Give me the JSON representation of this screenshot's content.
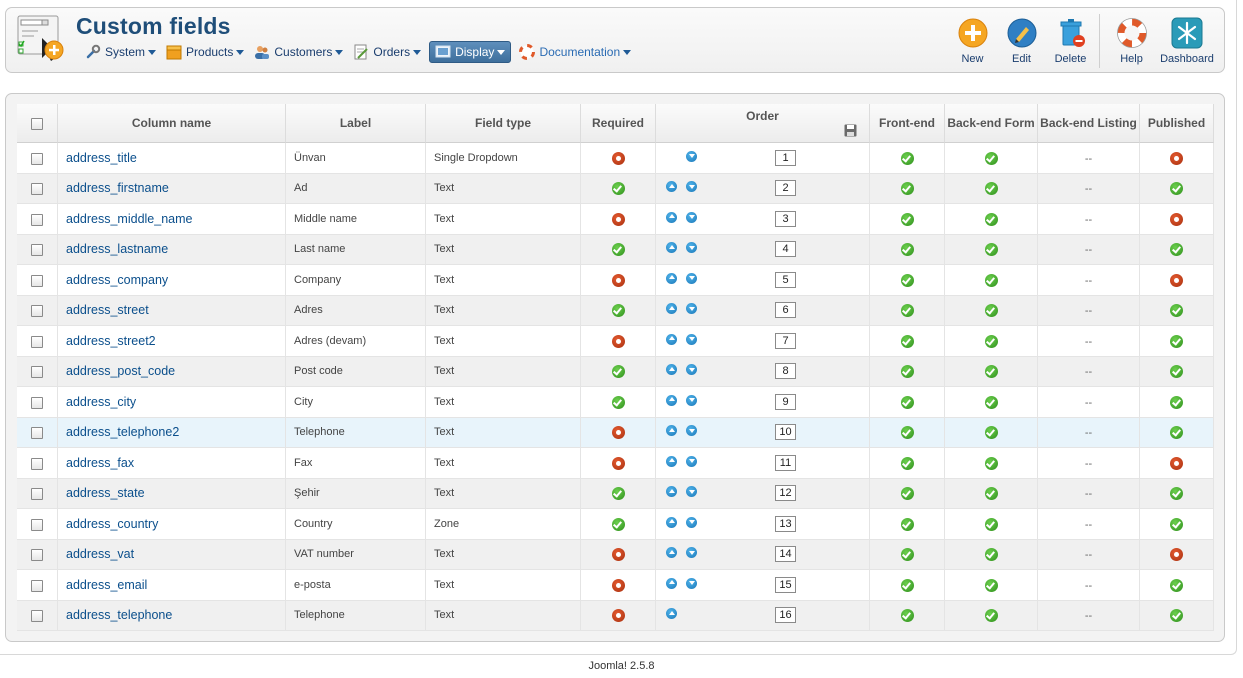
{
  "header": {
    "title": "Custom fields",
    "menu": [
      {
        "label": "System",
        "icon": "wrench-icon",
        "active": false
      },
      {
        "label": "Products",
        "icon": "box-icon",
        "active": false
      },
      {
        "label": "Customers",
        "icon": "users-icon",
        "active": false
      },
      {
        "label": "Orders",
        "icon": "orders-icon",
        "active": false
      },
      {
        "label": "Display",
        "icon": "display-icon",
        "active": true
      },
      {
        "label": "Documentation",
        "icon": "lifebuoy-icon",
        "active": false
      }
    ],
    "toolbar": {
      "new_label": "New",
      "edit_label": "Edit",
      "delete_label": "Delete",
      "help_label": "Help",
      "dashboard_label": "Dashboard"
    }
  },
  "table": {
    "headers": {
      "column_name": "Column name",
      "label": "Label",
      "field_type": "Field type",
      "required": "Required",
      "order": "Order",
      "front_end": "Front-end",
      "back_end_form": "Back-end Form",
      "back_end_listing": "Back-end Listing",
      "published": "Published"
    },
    "rows": [
      {
        "column": "address_title",
        "label": "Ünvan",
        "type": "Single Dropdown",
        "required": false,
        "up": false,
        "down": true,
        "order": "1",
        "front": true,
        "backform": true,
        "listing": "--",
        "published": false
      },
      {
        "column": "address_firstname",
        "label": "Ad",
        "type": "Text",
        "required": true,
        "up": true,
        "down": true,
        "order": "2",
        "front": true,
        "backform": true,
        "listing": "--",
        "published": true
      },
      {
        "column": "address_middle_name",
        "label": "Middle name",
        "type": "Text",
        "required": false,
        "up": true,
        "down": true,
        "order": "3",
        "front": true,
        "backform": true,
        "listing": "--",
        "published": false
      },
      {
        "column": "address_lastname",
        "label": "Last name",
        "type": "Text",
        "required": true,
        "up": true,
        "down": true,
        "order": "4",
        "front": true,
        "backform": true,
        "listing": "--",
        "published": true
      },
      {
        "column": "address_company",
        "label": "Company",
        "type": "Text",
        "required": false,
        "up": true,
        "down": true,
        "order": "5",
        "front": true,
        "backform": true,
        "listing": "--",
        "published": false
      },
      {
        "column": "address_street",
        "label": "Adres",
        "type": "Text",
        "required": true,
        "up": true,
        "down": true,
        "order": "6",
        "front": true,
        "backform": true,
        "listing": "--",
        "published": true
      },
      {
        "column": "address_street2",
        "label": "Adres (devam)",
        "type": "Text",
        "required": false,
        "up": true,
        "down": true,
        "order": "7",
        "front": true,
        "backform": true,
        "listing": "--",
        "published": true
      },
      {
        "column": "address_post_code",
        "label": "Post code",
        "type": "Text",
        "required": true,
        "up": true,
        "down": true,
        "order": "8",
        "front": true,
        "backform": true,
        "listing": "--",
        "published": true
      },
      {
        "column": "address_city",
        "label": "City",
        "type": "Text",
        "required": true,
        "up": true,
        "down": true,
        "order": "9",
        "front": true,
        "backform": true,
        "listing": "--",
        "published": true
      },
      {
        "column": "address_telephone2",
        "label": "Telephone",
        "type": "Text",
        "required": false,
        "up": true,
        "down": true,
        "order": "10",
        "front": true,
        "backform": true,
        "listing": "--",
        "published": true
      },
      {
        "column": "address_fax",
        "label": "Fax",
        "type": "Text",
        "required": false,
        "up": true,
        "down": true,
        "order": "11",
        "front": true,
        "backform": true,
        "listing": "--",
        "published": false
      },
      {
        "column": "address_state",
        "label": "Şehir",
        "type": "Text",
        "required": true,
        "up": true,
        "down": true,
        "order": "12",
        "front": true,
        "backform": true,
        "listing": "--",
        "published": true
      },
      {
        "column": "address_country",
        "label": "Country",
        "type": "Zone",
        "required": true,
        "up": true,
        "down": true,
        "order": "13",
        "front": true,
        "backform": true,
        "listing": "--",
        "published": true
      },
      {
        "column": "address_vat",
        "label": "VAT number",
        "type": "Text",
        "required": false,
        "up": true,
        "down": true,
        "order": "14",
        "front": true,
        "backform": true,
        "listing": "--",
        "published": false
      },
      {
        "column": "address_email",
        "label": "e-posta",
        "type": "Text",
        "required": false,
        "up": true,
        "down": true,
        "order": "15",
        "front": true,
        "backform": true,
        "listing": "--",
        "published": true
      },
      {
        "column": "address_telephone",
        "label": "Telephone",
        "type": "Text",
        "required": false,
        "up": true,
        "down": false,
        "order": "16",
        "front": true,
        "backform": true,
        "listing": "--",
        "published": true
      }
    ]
  },
  "footer": {
    "version": "Joomla! 2.5.8"
  },
  "colors": {
    "title": "#1f4e79",
    "link": "#0b4f8c",
    "ok": "#2f8f1c",
    "no": "#a8300f",
    "accent": "#3e6f9c"
  }
}
